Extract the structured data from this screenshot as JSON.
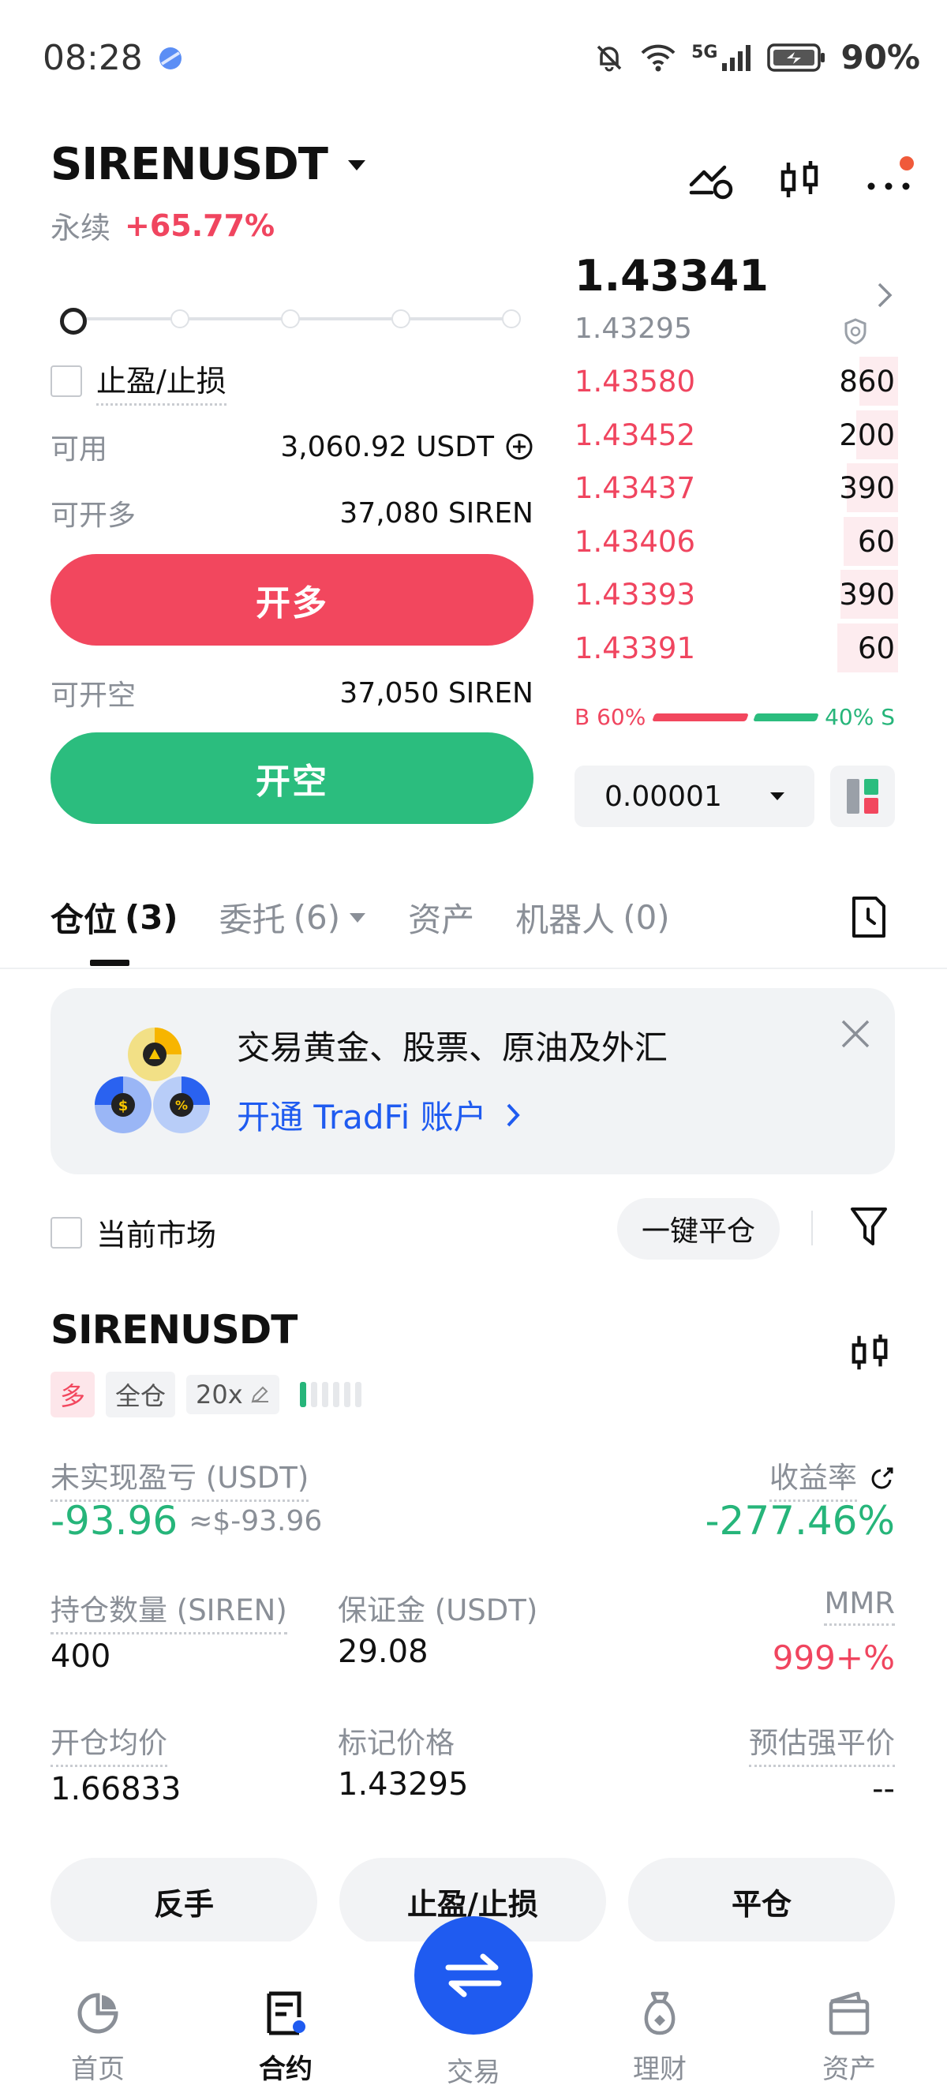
{
  "status_bar": {
    "time": "08:28",
    "network": "5G",
    "battery": "90%"
  },
  "header": {
    "pair": "SIRENUSDT",
    "contract_type": "永续",
    "change": "+65.77%"
  },
  "order_form": {
    "tpsl_label": "止盈/止损",
    "available_label": "可用",
    "available_value": "3,060.92 USDT",
    "can_long_label": "可开多",
    "can_long_value": "37,080 SIREN",
    "open_long_button": "开多",
    "can_short_label": "可开空",
    "can_short_value": "37,050 SIREN",
    "open_short_button": "开空"
  },
  "order_book": {
    "last_price": "1.43341",
    "mark_price": "1.43295",
    "asks": [
      {
        "price": "1.43580",
        "qty": "860",
        "depth": 0.12
      },
      {
        "price": "1.43452",
        "qty": "200",
        "depth": 0.13
      },
      {
        "price": "1.43437",
        "qty": "390",
        "depth": 0.16
      },
      {
        "price": "1.43406",
        "qty": "60",
        "depth": 0.17
      },
      {
        "price": "1.43393",
        "qty": "390",
        "depth": 0.18
      },
      {
        "price": "1.43391",
        "qty": "60",
        "depth": 0.19
      }
    ],
    "buy_ratio_label": "B 60%",
    "sell_ratio_label": "40% S",
    "buy_ratio": 0.6,
    "precision": "0.00001"
  },
  "tabs": [
    {
      "label": "仓位",
      "count": "(3)"
    },
    {
      "label": "委托",
      "count": "(6)"
    },
    {
      "label": "资产",
      "count": ""
    },
    {
      "label": "机器人",
      "count": "(0)"
    }
  ],
  "banner": {
    "title": "交易黄金、股票、原油及外汇",
    "link": "开通 TradFi 账户"
  },
  "filter": {
    "current_market_label": "当前市场",
    "close_all_button": "一键平仓"
  },
  "position": {
    "symbol": "SIRENUSDT",
    "side": "多",
    "margin_mode": "全仓",
    "leverage": "20x",
    "pnl_label": "未实现盈亏 (USDT)",
    "pnl_value": "-93.96",
    "pnl_usd": "≈$-93.96",
    "roe_label": "收益率",
    "roe_value": "-277.46%",
    "size_label": "持仓数量 (SIREN)",
    "size_value": "400",
    "margin_label": "保证金 (USDT)",
    "margin_value": "29.08",
    "mmr_label": "MMR",
    "mmr_value": "999+%",
    "entry_label": "开仓均价",
    "entry_value": "1.66833",
    "mark_label": "标记价格",
    "mark_value": "1.43295",
    "liq_label": "预估强平价",
    "liq_value": "--",
    "reverse_button": "反手",
    "tpsl_button": "止盈/止损",
    "close_button": "平仓"
  },
  "bottom_nav": [
    {
      "label": "首页",
      "icon": "home-icon"
    },
    {
      "label": "合约",
      "icon": "contract-icon"
    },
    {
      "label": "交易",
      "icon": "trade-swap-icon"
    },
    {
      "label": "理财",
      "icon": "earn-icon"
    },
    {
      "label": "资产",
      "icon": "wallet-icon"
    }
  ],
  "colors": {
    "long": "#f2475e",
    "short": "#2bbd7e",
    "accent": "#1f5bf0"
  }
}
